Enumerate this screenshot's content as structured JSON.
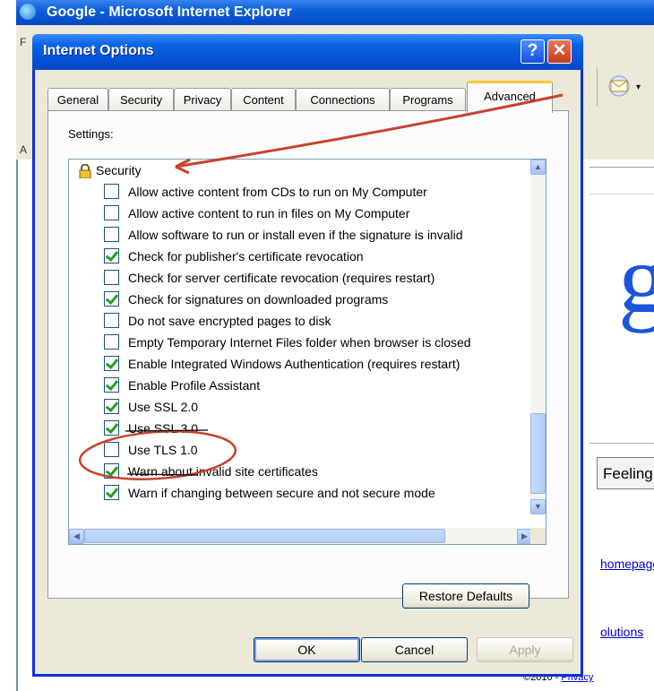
{
  "browser": {
    "title": "Google - Microsoft Internet Explorer",
    "menu_initial": "F",
    "address_initial": "A",
    "feeling_button": "Feeling",
    "homepage_link": "homepage",
    "solutions_link": "olutions",
    "footer_copyright": "©2010 - ",
    "footer_privacy": "Privacy",
    "google_logo_fragment": "g"
  },
  "dialog": {
    "title": "Internet Options",
    "help_button": "?",
    "close_button": "✕",
    "tabs": [
      {
        "label": "General"
      },
      {
        "label": "Security"
      },
      {
        "label": "Privacy"
      },
      {
        "label": "Content"
      },
      {
        "label": "Connections"
      },
      {
        "label": "Programs"
      },
      {
        "label": "Advanced",
        "active": true
      }
    ],
    "settings_label": "Settings:",
    "group_header": "Security",
    "items": [
      {
        "label": "Allow active content from CDs to run on My Computer",
        "checked": false
      },
      {
        "label": "Allow active content to run in files on My Computer",
        "checked": false
      },
      {
        "label": "Allow software to run or install even if the signature is invalid",
        "checked": false
      },
      {
        "label": "Check for publisher's certificate revocation",
        "checked": true
      },
      {
        "label": "Check for server certificate revocation (requires restart)",
        "checked": false
      },
      {
        "label": "Check for signatures on downloaded programs",
        "checked": true
      },
      {
        "label": "Do not save encrypted pages to disk",
        "checked": false
      },
      {
        "label": "Empty Temporary Internet Files folder when browser is closed",
        "checked": false
      },
      {
        "label": "Enable Integrated Windows Authentication (requires restart)",
        "checked": true
      },
      {
        "label": "Enable Profile Assistant",
        "checked": true
      },
      {
        "label": "Use SSL 2.0",
        "checked": true
      },
      {
        "label": "Use SSL 3.0",
        "checked": true
      },
      {
        "label": "Use TLS 1.0",
        "checked": false
      },
      {
        "label": "Warn about invalid site certificates",
        "checked": true
      },
      {
        "label": "Warn if changing between secure and not secure mode",
        "checked": true
      }
    ],
    "restore_defaults": "Restore Defaults",
    "ok": "OK",
    "cancel": "Cancel",
    "apply": "Apply"
  },
  "colors": {
    "annotation": "#c8412c",
    "titlebar": "#0a63e6",
    "dialog_bg": "#ece9d8"
  }
}
